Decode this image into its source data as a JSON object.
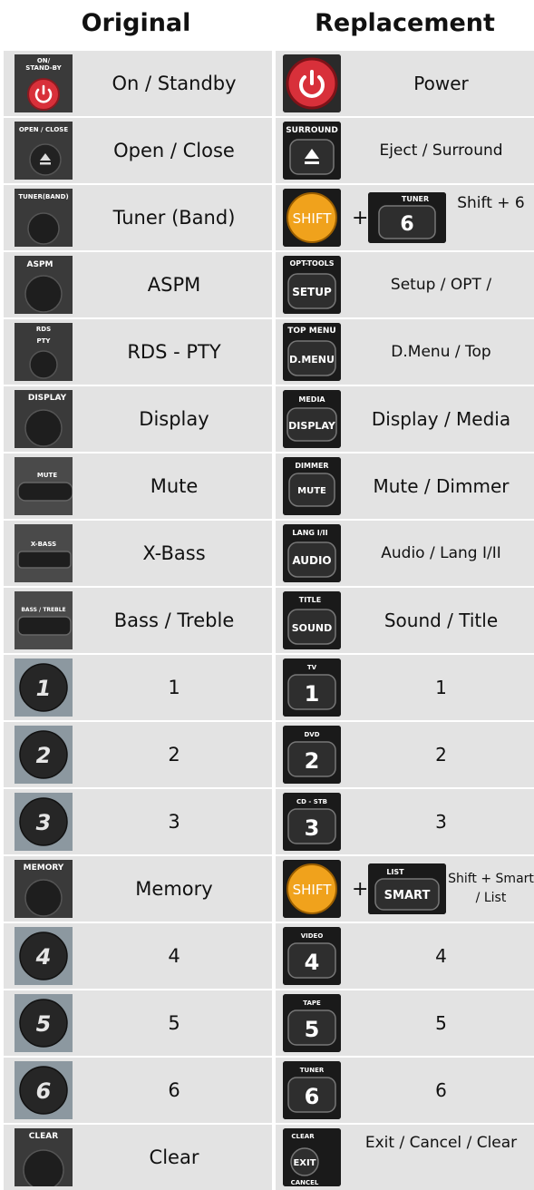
{
  "header": {
    "original": "Original",
    "replacement": "Replacement"
  },
  "rows": [
    {
      "orig_label": "On / Standby",
      "orig_icon": "power-standby-button-icon",
      "orig_caption": [
        "ON/",
        "STAND-BY"
      ],
      "repl_label": "Power",
      "repl_icon": "power-button-icon"
    },
    {
      "orig_label": "Open / Close",
      "orig_icon": "eject-button-icon",
      "orig_caption": [
        "OPEN / CLOSE"
      ],
      "repl_label": "Eject / Surround",
      "repl_icon": "eject-button-icon",
      "repl_caption": "SURROUND"
    },
    {
      "orig_label": "Tuner (Band)",
      "orig_icon": "round-button-icon",
      "orig_caption": [
        "TUNER(BAND)"
      ],
      "repl_label": "Shift + 6",
      "repl_icon": "shift-button-icon",
      "repl_key": "SHIFT",
      "plus": "+",
      "repl_icon2": "number-6-button-icon",
      "repl_caption2": "TUNER",
      "repl_key2": "6"
    },
    {
      "orig_label": "ASPM",
      "orig_icon": "round-button-icon",
      "orig_caption": [
        "ASPM"
      ],
      "repl_label": "Setup / OPT /",
      "repl_icon": "setup-button-icon",
      "repl_caption": "OPT-TOOLS",
      "repl_key": "SETUP"
    },
    {
      "orig_label": "RDS - PTY",
      "orig_icon": "round-button-icon",
      "orig_caption": [
        "RDS",
        "PTY"
      ],
      "repl_label": "D.Menu / Top",
      "repl_icon": "dmenu-button-icon",
      "repl_caption": "TOP MENU",
      "repl_key": "D.MENU"
    },
    {
      "orig_label": "Display",
      "orig_icon": "round-button-icon",
      "orig_caption": [
        "DISPLAY"
      ],
      "repl_label": "Display / Media",
      "repl_icon": "display-button-icon",
      "repl_caption": "MEDIA",
      "repl_key": "DISPLAY"
    },
    {
      "orig_label": "Mute",
      "orig_icon": "flat-button-icon",
      "orig_caption": [
        "MUTE"
      ],
      "repl_label": "Mute / Dimmer",
      "repl_icon": "mute-button-icon",
      "repl_caption": "DIMMER",
      "repl_key": "MUTE"
    },
    {
      "orig_label": "X-Bass",
      "orig_icon": "flat-button-icon",
      "orig_caption": [
        "X-BASS"
      ],
      "repl_label": "Audio / Lang I/II",
      "repl_icon": "audio-button-icon",
      "repl_caption": "LANG I/II",
      "repl_key": "AUDIO"
    },
    {
      "orig_label": "Bass / Treble",
      "orig_icon": "flat-button-icon",
      "orig_caption": [
        "BASS / TREBLE"
      ],
      "repl_label": "Sound / Title",
      "repl_icon": "sound-button-icon",
      "repl_caption": "TITLE",
      "repl_key": "SOUND"
    },
    {
      "orig_label": "1",
      "orig_icon": "number-1-button-icon",
      "orig_key": "1",
      "repl_label": "1",
      "repl_icon": "number-1-button-icon",
      "repl_caption": "TV",
      "repl_key": "1"
    },
    {
      "orig_label": "2",
      "orig_icon": "number-2-button-icon",
      "orig_key": "2",
      "repl_label": "2",
      "repl_icon": "number-2-button-icon",
      "repl_caption": "DVD",
      "repl_key": "2"
    },
    {
      "orig_label": "3",
      "orig_icon": "number-3-button-icon",
      "orig_key": "3",
      "repl_label": "3",
      "repl_icon": "number-3-button-icon",
      "repl_caption": "CD - STB",
      "repl_key": "3"
    },
    {
      "orig_label": "Memory",
      "orig_icon": "round-button-icon",
      "orig_caption": [
        "MEMORY"
      ],
      "repl_label": "Shift + Smart / List",
      "repl_icon": "shift-button-icon",
      "repl_key": "SHIFT",
      "plus": "+",
      "repl_icon2": "smart-button-icon",
      "repl_caption2": "LIST",
      "repl_key2": "SMART"
    },
    {
      "orig_label": "4",
      "orig_icon": "number-4-button-icon",
      "orig_key": "4",
      "repl_label": "4",
      "repl_icon": "number-4-button-icon",
      "repl_caption": "VIDEO",
      "repl_key": "4"
    },
    {
      "orig_label": "5",
      "orig_icon": "number-5-button-icon",
      "orig_key": "5",
      "repl_label": "5",
      "repl_icon": "number-5-button-icon",
      "repl_caption": "TAPE",
      "repl_key": "5"
    },
    {
      "orig_label": "6",
      "orig_icon": "number-6-button-icon",
      "orig_key": "6",
      "repl_label": "6",
      "repl_icon": "number-6-button-icon",
      "repl_caption": "TUNER",
      "repl_key": "6"
    },
    {
      "orig_label": "Clear",
      "orig_icon": "round-button-icon",
      "orig_caption": [
        "CLEAR"
      ],
      "repl_label": "Exit / Cancel / Clear",
      "repl_icon": "exit-button-icon",
      "repl_caption": "CLEAR",
      "repl_key": "EXIT",
      "repl_caption_bottom": "CANCEL"
    }
  ],
  "colors": {
    "cell_bg": "#e3e3e3",
    "power_red": "#d8303a",
    "shift_orange": "#f0a21c"
  }
}
